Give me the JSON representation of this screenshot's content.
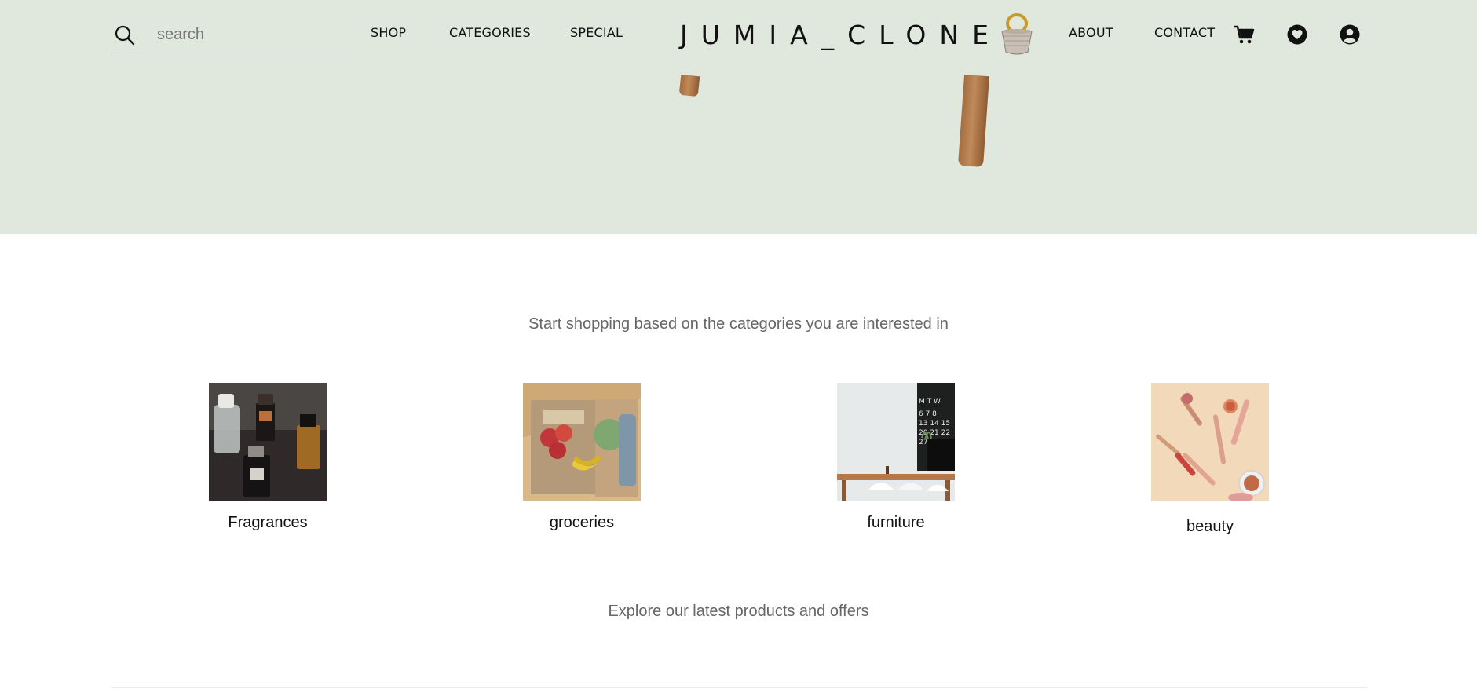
{
  "header": {
    "search_placeholder": "search",
    "nav_left": [
      "SHOP",
      "CATEGORIES",
      "SPECIAL"
    ],
    "logo_text": "JUMIA_CLONE",
    "nav_right": [
      "ABOUT",
      "CONTACT"
    ],
    "icons": [
      "search-icon",
      "cart-icon",
      "heart-icon",
      "user-icon"
    ]
  },
  "categories_section": {
    "heading": "Start shopping based on the categories you are interested in",
    "items": [
      {
        "label": "Fragrances",
        "image": "perfume-bottles"
      },
      {
        "label": "groceries",
        "image": "grocery-bags"
      },
      {
        "label": "furniture",
        "image": "dining-table"
      },
      {
        "label": "beauty",
        "image": "makeup-products"
      }
    ]
  },
  "latest_section": {
    "heading": "Explore our latest products and offers"
  },
  "colors": {
    "hero_background": "#e0e7dc",
    "page_background": "#ffffff",
    "heading_text": "#666666",
    "nav_text": "#111111"
  }
}
